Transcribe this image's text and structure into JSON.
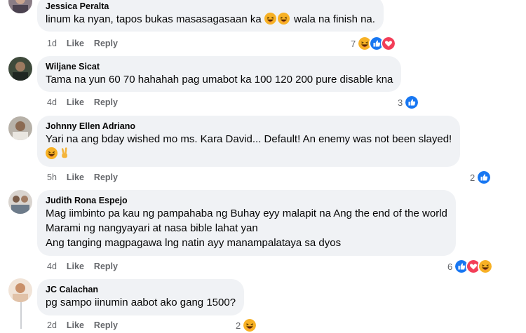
{
  "comments": [
    {
      "author": "Jessica Peralta",
      "text": "linum ka nyan, tapos bukas masasagasaan ka",
      "text_after": "wala na finish na.",
      "time": "1d",
      "like": "Like",
      "reply": "Reply",
      "reaction_count": "7",
      "reactions": [
        "haha-icon",
        "like-icon",
        "love-icon"
      ]
    },
    {
      "author": "Wiljane Sicat",
      "text": "Tama na yun 60 70 hahahah pag umabot ka 100 120 200 pure disable kna",
      "time": "4d",
      "like": "Like",
      "reply": "Reply",
      "reaction_count": "3",
      "reactions": [
        "like-icon"
      ]
    },
    {
      "author": "Johnny Ellen Adriano",
      "text": "Yari na ang bday wished mo ms. Kara David... Default! An enemy was not been slayed!",
      "time": "5h",
      "like": "Like",
      "reply": "Reply",
      "reaction_count": "2",
      "reactions": [
        "like-icon"
      ]
    },
    {
      "author": "Judith Rona Espejo",
      "lines": [
        "Mag iimbinto pa kau ng pampahaba ng Buhay eyy malapit na Ang the end of the world",
        "Marami ng nangyayari at nasa bible lahat yan",
        "Ang tanging magpagawa lng natin ayy manampalataya sa dyos"
      ],
      "time": "4d",
      "like": "Like",
      "reply": "Reply",
      "reaction_count": "6",
      "reactions": [
        "like-icon",
        "love-icon",
        "haha-icon"
      ]
    },
    {
      "author": "JC Calachan",
      "text": "pg sampo iinumin aabot ako gang 1500?",
      "time": "2d",
      "like": "Like",
      "reply": "Reply",
      "reaction_count": "2",
      "reactions": [
        "haha-icon"
      ]
    }
  ],
  "colors": {
    "bubble": "#f0f2f5",
    "meta": "#65676b",
    "like_blue": "#1877f2",
    "love_red": "#f33e58",
    "haha_yellow": "#f7b125"
  }
}
